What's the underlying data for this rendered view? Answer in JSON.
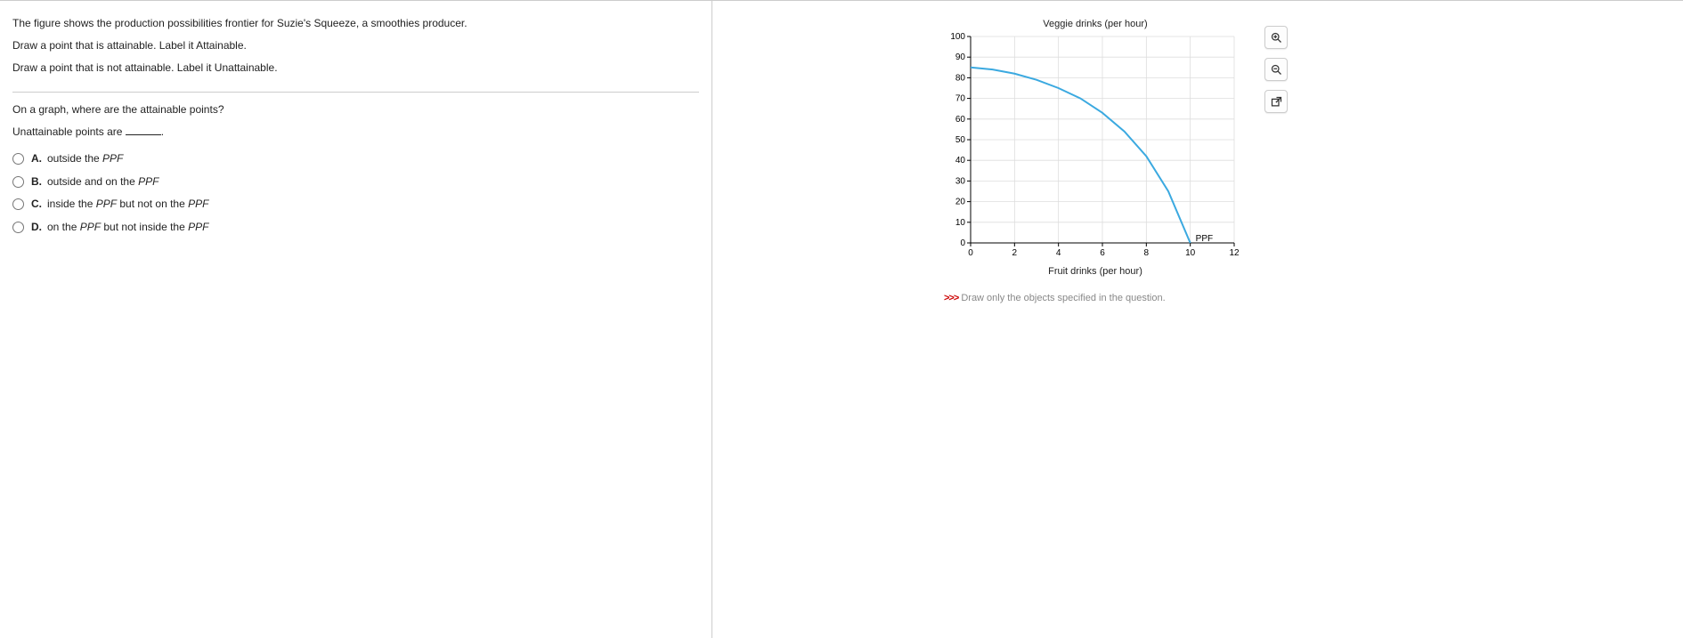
{
  "question": {
    "intro_line1": "The figure shows the production possibilities frontier for Suzie's Squeeze, a smoothies producer.",
    "intro_line2": "Draw a point that is attainable. Label it Attainable.",
    "intro_line3": "Draw a point that is not attainable. Label it Unattainable.",
    "q_line1": "On a graph, where are the attainable points?",
    "q_line2_pre": "Unattainable points are ",
    "q_line2_post": ".",
    "options": [
      {
        "letter": "A.",
        "text_pre": "outside the ",
        "text_italic": "PPF",
        "text_post": ""
      },
      {
        "letter": "B.",
        "text_pre": "outside and on the ",
        "text_italic": "PPF",
        "text_post": ""
      },
      {
        "letter": "C.",
        "text_pre": "inside the ",
        "text_italic": "PPF",
        "text_post": " but not on the ",
        "text_italic2": "PPF"
      },
      {
        "letter": "D.",
        "text_pre": "on the ",
        "text_italic": "PPF",
        "text_post": " but not inside the ",
        "text_italic2": "PPF"
      }
    ]
  },
  "chart_data": {
    "type": "line",
    "title": "Veggie drinks (per hour)",
    "xlabel": "Fruit drinks (per hour)",
    "ylabel": "",
    "xlim": [
      0,
      12
    ],
    "ylim": [
      0,
      100
    ],
    "x_ticks": [
      0,
      2,
      4,
      6,
      8,
      10,
      12
    ],
    "y_ticks": [
      0,
      10,
      20,
      30,
      40,
      50,
      60,
      70,
      80,
      90,
      100
    ],
    "series": [
      {
        "name": "PPF",
        "color": "#3ba9e0",
        "x": [
          0,
          1,
          2,
          3,
          4,
          5,
          6,
          7,
          8,
          9,
          10
        ],
        "values": [
          85,
          84,
          82,
          79,
          75,
          70,
          63,
          54,
          42,
          25,
          0
        ]
      }
    ],
    "curve_label": "PPF"
  },
  "instruction": {
    "chevrons": ">>>",
    "text": " Draw only the objects specified in the question."
  },
  "tools": {
    "zoom_in": "zoom-in",
    "zoom_out": "zoom-out",
    "popout": "popout"
  }
}
